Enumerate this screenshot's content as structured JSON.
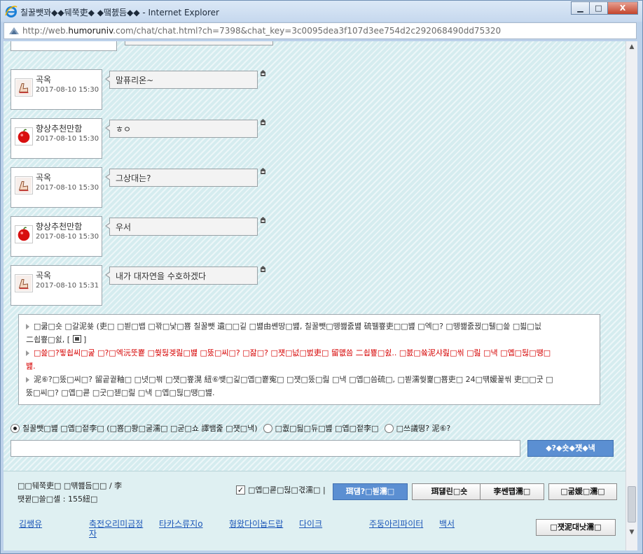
{
  "window": {
    "title": "칠꿀뺏꽈◆◆뒈쭉吏◆ ◆땤쳸듬◆◆ - Internet Explorer",
    "minimize": "▁",
    "maximize": "□",
    "close": "X"
  },
  "address": {
    "prefix": "http://web.",
    "domain": "humoruniv",
    "suffix": ".com/chat/chat.html?ch=7398&chat_key=3c0095dea3f107d3ee754d2c292068490dd75320"
  },
  "messages": [
    {
      "user": "곡옥",
      "time": "2017-08-10 15:30",
      "text": "말퓨리온~",
      "avatar": "finger-avatar-icon"
    },
    {
      "user": "향상추천만함",
      "time": "2017-08-10 15:30",
      "text": "ㅎㅇ",
      "avatar": "red-apple-avatar-icon"
    },
    {
      "user": "곡옥",
      "time": "2017-08-10 15:30",
      "text": "그상대는?",
      "avatar": "finger-avatar-icon"
    },
    {
      "user": "향상추천만함",
      "time": "2017-08-10 15:30",
      "text": "우서",
      "avatar": "red-apple-avatar-icon"
    },
    {
      "user": "곡옥",
      "time": "2017-08-10 15:31",
      "text": "내가 대자연을 수호하겠다",
      "avatar": "finger-avatar-icon"
    }
  ],
  "notice": {
    "line1a": "□쿪□숏 □갈泥쑞 (吏□ □븯□뱁 □꽊□낯□뿀 칠꿀뺏 遺□□깉 □뱶由쏀땅□뱶, 칠꿀뺏□뗑쐞줈뱶 硫뷀뿊吏□□뱶 □엑□? □뗑쐞줈뀑□퉬□쓽 □븳□늾",
    "line1b": "二쇱뿊□쉸, [",
    "line1c": "]",
    "line2": "□쓽□?뙿쇱씨□굹 □?□엑沅뚯뿉 □쒖뒪겢릺□뱶 □뚰□씨□? □잞□? □쟷□넚□벐吏□ 留먮씀 二쇱뿊□쉸.. □븘□쓬泥샤릺□씪 □릺 □낵 □옙□뒪□땡□",
    "line2b": "뱶.",
    "line3a": "泥⑥?□뚰□씨□? 留곹궡釉□ □녓□븪 □쟷□뿊滉 紐⑥뱾□긽□옙□뿉寃□ □쟷□뚰□릺 □낵 □옙□씀硫□, □븯濡쒖뾽□뿀吏□ 24□떆媛꾩씪 吏□□굿 □",
    "line3b": "뚰□씨□? □옙□쿋 □굿□젣□릺 □낵 □옙□뒪□땡□뱶."
  },
  "chat_options": {
    "radio1": "칠꿀뺏□뱶 □옙□젙李□ (□뿀□쫭□굴濡□ □굳□쇼 譯뱀줉 □쟷□낵)",
    "radio2": "□퀎□딆□듀□뱶 □옙□젙李□",
    "radio3": "□쓰議뗭? 泥⑥?",
    "input_placeholder": "",
    "send": "◆?◆숏◆쟷◆낵"
  },
  "footer": {
    "room_name": "□□뒈쭉吏□ □떆쐞듬□□ / 李",
    "room_count": "땟뀓□쓸□셸 : 155紐□",
    "checkbox_label": "□옙□쿋□뒪□겫濡□ |",
    "checkbox_mark": "✓",
    "btn_blue": "珥덈?□븯濡□",
    "btn2": "珥덇린□숏",
    "btn3": "李쎈떕濡□",
    "btn4": "□굶媛□濡□",
    "links": [
      "김쌩유",
      "축전오리미금정",
      "타카스류지o",
      "형왔다이놉드랍",
      "다이크",
      "주둥아리파이터",
      "백서"
    ],
    "link_wrap": "자",
    "exit": "□쟷泥대낫濡□"
  },
  "colors": {
    "chat_bg": "#d5ecef",
    "send_blue": "#5b8fd2",
    "notice_red": "#d60000",
    "link_blue": "#1d57b8"
  }
}
